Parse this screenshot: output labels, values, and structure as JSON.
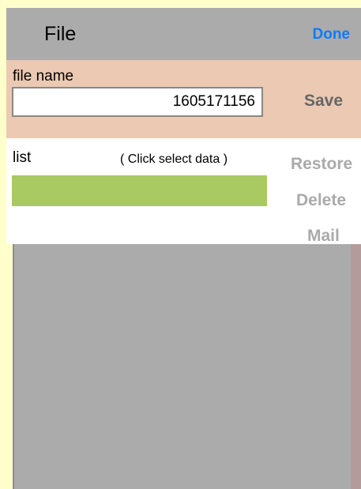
{
  "header": {
    "title": "File",
    "done_label": "Done"
  },
  "save_section": {
    "file_name_label": "file name",
    "file_name_value": "1605171156",
    "save_label": "Save"
  },
  "list_section": {
    "list_label": "list",
    "hint": "( Click select data )",
    "items": [
      {
        "label": ""
      }
    ],
    "restore_label": "Restore",
    "delete_label": "Delete",
    "mail_label": "Mail"
  },
  "colors": {
    "page_background": "#ffffcc",
    "header_background": "#ababab",
    "accent": "#0a7bff",
    "save_section_background": "#ebc9b2",
    "list_item_fill": "#a9c963",
    "disabled_text": "#aaaaaa",
    "data_area_background": "#ababab",
    "scrollbar": "#b39b9b"
  }
}
